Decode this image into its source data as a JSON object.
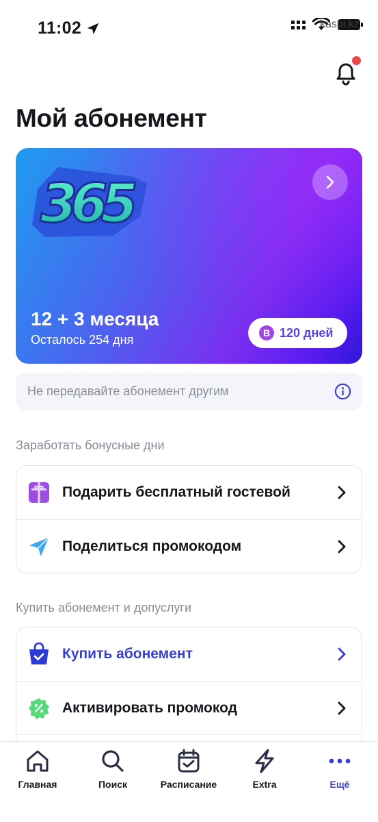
{
  "status_bar": {
    "time": "11:02",
    "watermark": "kaspi.kz"
  },
  "header": {
    "title": "Мой абонемент",
    "notification_dot_color": "#f2444f"
  },
  "subscription_card": {
    "logo_text": "365",
    "plan": "12 + 3 месяца",
    "remaining": "Осталось 254 дня",
    "bonus_badge_letter": "B",
    "bonus_days": "120 дней",
    "gradient_colors": [
      "#1f9cf0",
      "#7b2ef0",
      "#2f17d8"
    ]
  },
  "notice": {
    "text": "Не передавайте абонемент другим",
    "icon": "info-icon"
  },
  "bonus_section": {
    "title": "Заработать бонусные дни",
    "items": [
      {
        "label": "Подарить бесплатный гостевой",
        "icon": "gift-icon"
      },
      {
        "label": "Поделиться промокодом",
        "icon": "send-icon"
      }
    ]
  },
  "buy_section": {
    "title": "Купить абонемент и допуслуги",
    "items": [
      {
        "label": "Купить абонемент",
        "icon": "shopping-bag-icon",
        "accent": true
      },
      {
        "label": "Активировать промокод",
        "icon": "promo-badge-icon"
      }
    ]
  },
  "bottom_nav": {
    "items": [
      {
        "label": "Главная",
        "icon": "home-icon"
      },
      {
        "label": "Поиск",
        "icon": "search-icon"
      },
      {
        "label": "Расписание",
        "icon": "calendar-icon"
      },
      {
        "label": "Extra",
        "icon": "lightning-icon"
      },
      {
        "label": "Ещё",
        "icon": "more-dots-icon",
        "active": true
      }
    ],
    "active_color": "#3a3fd1"
  }
}
